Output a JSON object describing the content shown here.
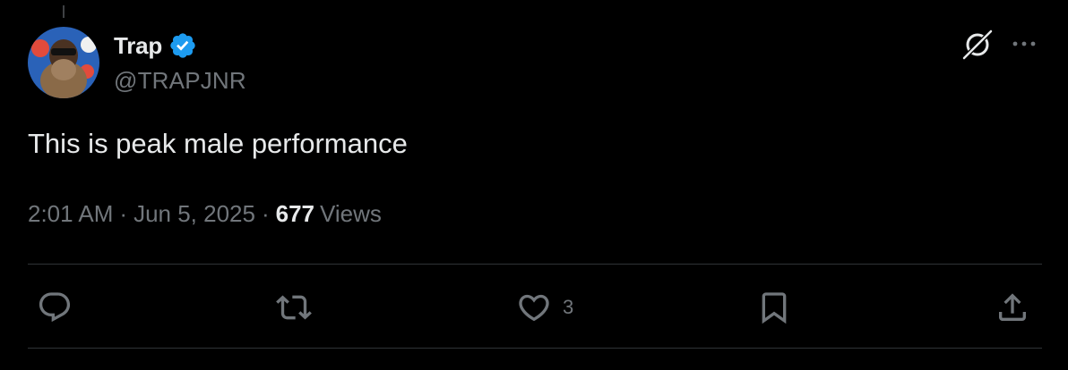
{
  "author": {
    "display_name": "Trap",
    "handle": "@TRAPJNR",
    "verified": true
  },
  "tweet": {
    "text": "This is peak male performance",
    "time": "2:01 AM",
    "date": "Jun 5, 2025",
    "views_count": "677",
    "views_label": "Views",
    "separator": "·"
  },
  "actions": {
    "reply": {
      "icon": "reply-icon"
    },
    "repost": {
      "icon": "repost-icon"
    },
    "like": {
      "icon": "heart-icon",
      "count": "3"
    },
    "bookmark": {
      "icon": "bookmark-icon"
    },
    "share": {
      "icon": "share-icon"
    }
  },
  "colors": {
    "background": "#000000",
    "primary_text": "#e7e9ea",
    "secondary_text": "#71767b",
    "verified_blue": "#1d9bf0",
    "divider": "#2f3336"
  }
}
